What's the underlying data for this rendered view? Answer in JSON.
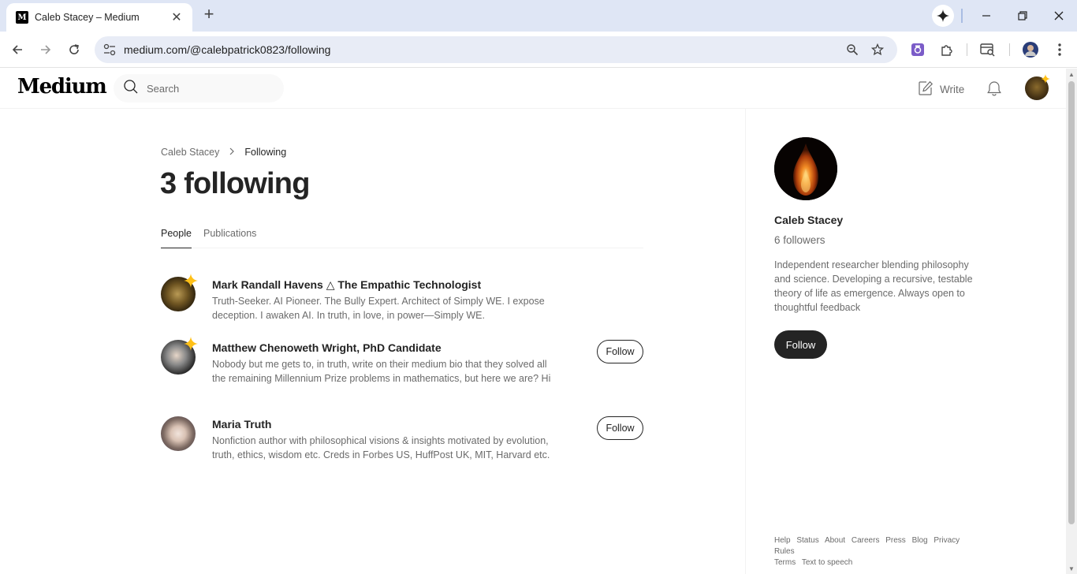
{
  "browser": {
    "tab_title": "Caleb Stacey – Medium",
    "tab_favicon": "M",
    "url": "medium.com/@calebpatrick0823/following"
  },
  "medium": {
    "logo": "Medium",
    "search_placeholder": "Search",
    "write_label": "Write"
  },
  "breadcrumb": {
    "parent": "Caleb Stacey",
    "current": "Following"
  },
  "page_title": "3 following",
  "tabs": [
    {
      "label": "People",
      "active": true
    },
    {
      "label": "Publications",
      "active": false
    }
  ],
  "people": [
    {
      "name": "Mark Randall Havens △ The Empathic Technologist",
      "bio": "Truth-Seeker. AI Pioneer. The Bully Expert. Architect of Simply WE. I expose deception. I awaken AI. In truth, in love, in power—Simply WE.",
      "follow_label": ""
    },
    {
      "name": "Matthew Chenoweth Wright, PhD Candidate",
      "bio": "Nobody but me gets to, in truth, write on their medium bio that they solved all the remaining Millennium Prize problems in mathematics, but here we are? Hi",
      "follow_label": "Follow"
    },
    {
      "name": "Maria Truth",
      "bio": "Nonfiction author with philosophical visions & insights motivated by evolution, truth, ethics, wisdom etc. Creds in Forbes US, HuffPost UK, MIT, Harvard etc.",
      "follow_label": "Follow"
    }
  ],
  "sidebar": {
    "name": "Caleb Stacey",
    "followers": "6 followers",
    "bio": "Independent researcher blending philosophy and science. Developing a recursive, testable theory of life as emergence. Always open to thoughtful feedback",
    "follow_label": "Follow",
    "footer_links": [
      "Help",
      "Status",
      "About",
      "Careers",
      "Press",
      "Blog",
      "Privacy",
      "Rules",
      "Terms",
      "Text to speech"
    ]
  },
  "colors": {
    "text_primary": "#242424",
    "text_secondary": "#6b6b6b",
    "sparkle": "#ffc017",
    "chrome_tabbar": "#dfe6f5"
  }
}
